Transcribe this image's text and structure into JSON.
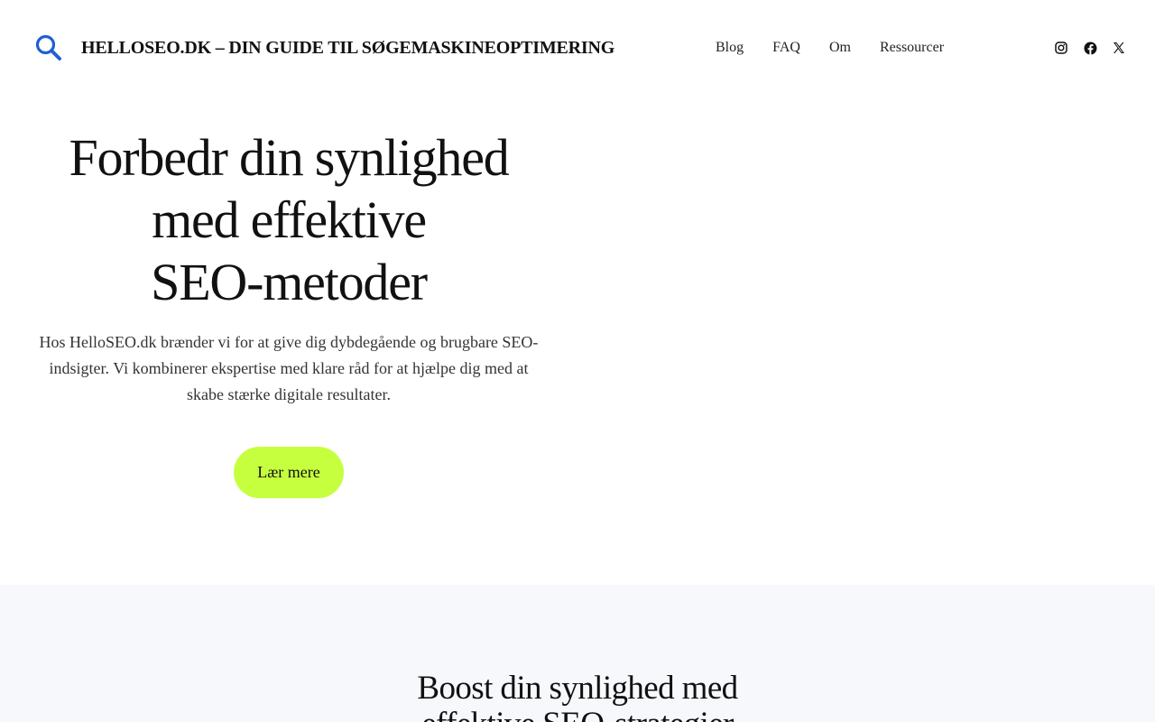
{
  "header": {
    "logo_icon": "search-icon",
    "site_title": "HELLOSEO.DK – DIN GUIDE TIL SØGEMASKINEOPTIMERING",
    "nav": [
      "Blog",
      "FAQ",
      "Om",
      "Ressourcer"
    ],
    "social": [
      "instagram-icon",
      "facebook-icon",
      "x-icon"
    ]
  },
  "hero": {
    "headline_lines": [
      "Forbedr din synlighed",
      "med effektive",
      "SEO-metoder"
    ],
    "body_lines": [
      "Hos HelloSEO.dk brænder vi for at give dig dybdegående og brugbare SEO-",
      "indsigter. Vi kombinerer ekspertise med klare råd for at hjælpe dig med at",
      "skabe stærke digitale resultater."
    ],
    "cta_label": "Lær mere"
  },
  "section2": {
    "heading_lines": [
      "Boost din synlighed med",
      "effektive SEO-strategier"
    ]
  },
  "colors": {
    "accent_blue": "#1e5fd6",
    "cta_green": "#c6ff3e",
    "section_bg": "#f6f8fc"
  }
}
